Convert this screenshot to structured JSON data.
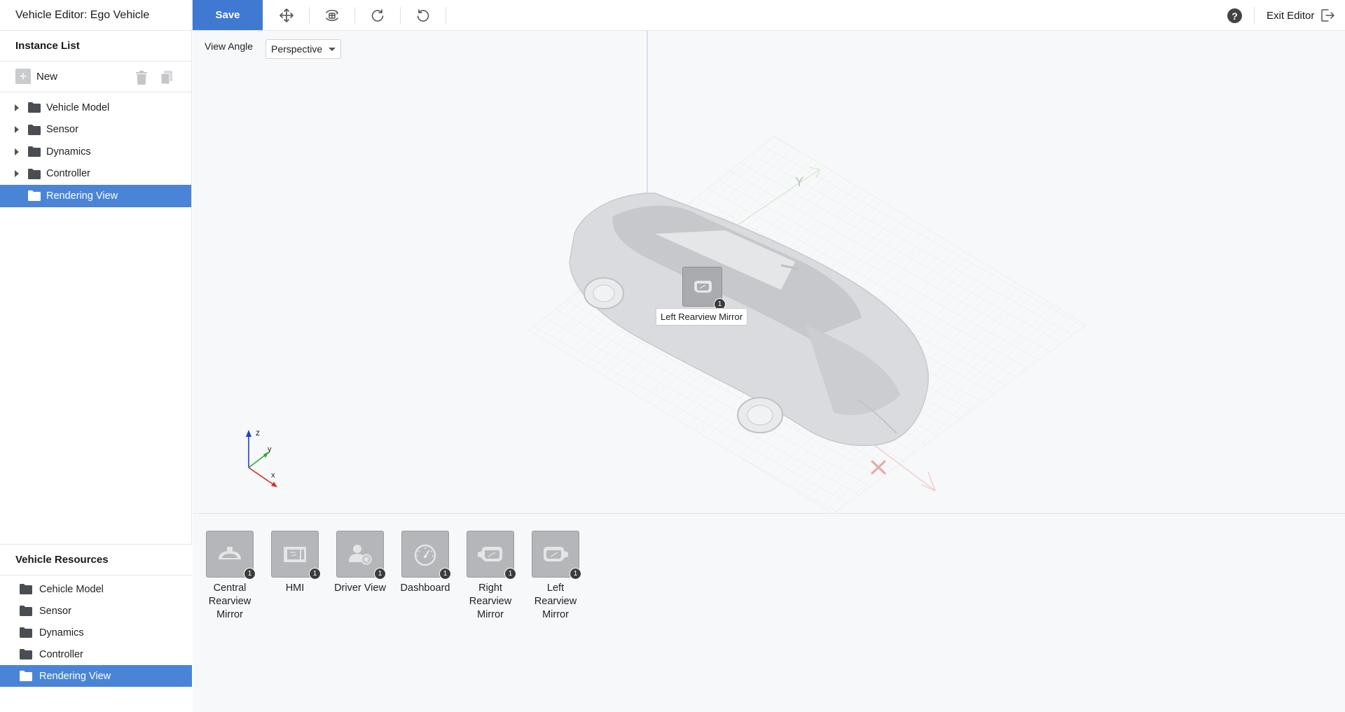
{
  "app": {
    "title": "Vehicle Editor: Ego Vehicle"
  },
  "toolbar": {
    "save_label": "Save",
    "tools": [
      "move-icon",
      "rotate-3d-icon",
      "redo-icon",
      "undo-icon"
    ],
    "exit_label": "Exit Editor",
    "help_glyph": "?"
  },
  "instance_list": {
    "title": "Instance List",
    "new_label": "New",
    "new_glyph": "+",
    "items": [
      {
        "label": "Vehicle Model",
        "expandable": true,
        "selected": false
      },
      {
        "label": "Sensor",
        "expandable": true,
        "selected": false
      },
      {
        "label": "Dynamics",
        "expandable": true,
        "selected": false
      },
      {
        "label": "Controller",
        "expandable": true,
        "selected": false
      },
      {
        "label": "Rendering View",
        "expandable": false,
        "selected": true
      }
    ]
  },
  "viewport": {
    "view_angle_label": "View Angle",
    "view_angle_value": "Perspective",
    "axis_labels": {
      "x": "x",
      "y": "Y",
      "z": "z",
      "y_small": "y"
    },
    "marker": {
      "badge": "1",
      "tooltip": "Left Rearview Mirror"
    }
  },
  "vehicle_resources": {
    "title": "Vehicle Resources",
    "items": [
      {
        "label": "Cehicle Model",
        "selected": false
      },
      {
        "label": "Sensor",
        "selected": false
      },
      {
        "label": "Dynamics",
        "selected": false
      },
      {
        "label": "Controller",
        "selected": false
      },
      {
        "label": "Rendering View",
        "selected": true
      }
    ]
  },
  "resource_tiles": [
    {
      "label": "Central Rearview Mirror",
      "lines": [
        "Central",
        "Rearview",
        "Mirror"
      ],
      "badge": "1",
      "icon": "central-mirror-icon"
    },
    {
      "label": "HMI",
      "lines": [
        "HMI"
      ],
      "badge": "1",
      "icon": "hmi-icon"
    },
    {
      "label": "Driver View",
      "lines": [
        "Driver View"
      ],
      "badge": "1",
      "icon": "driver-view-icon"
    },
    {
      "label": "Dashboard",
      "lines": [
        "Dashboard"
      ],
      "badge": "1",
      "icon": "dashboard-icon"
    },
    {
      "label": "Right Rearview Mirror",
      "lines": [
        "Right",
        "Rearview",
        "Mirror"
      ],
      "badge": "1",
      "icon": "right-mirror-icon"
    },
    {
      "label": "Left Rearview Mirror",
      "lines": [
        "Left",
        "Rearview",
        "Mirror"
      ],
      "badge": "1",
      "icon": "left-mirror-icon"
    }
  ],
  "colors": {
    "accent": "#3f79d2",
    "selected_row": "#4a84d6",
    "tile_bg": "#b4b6ba"
  }
}
